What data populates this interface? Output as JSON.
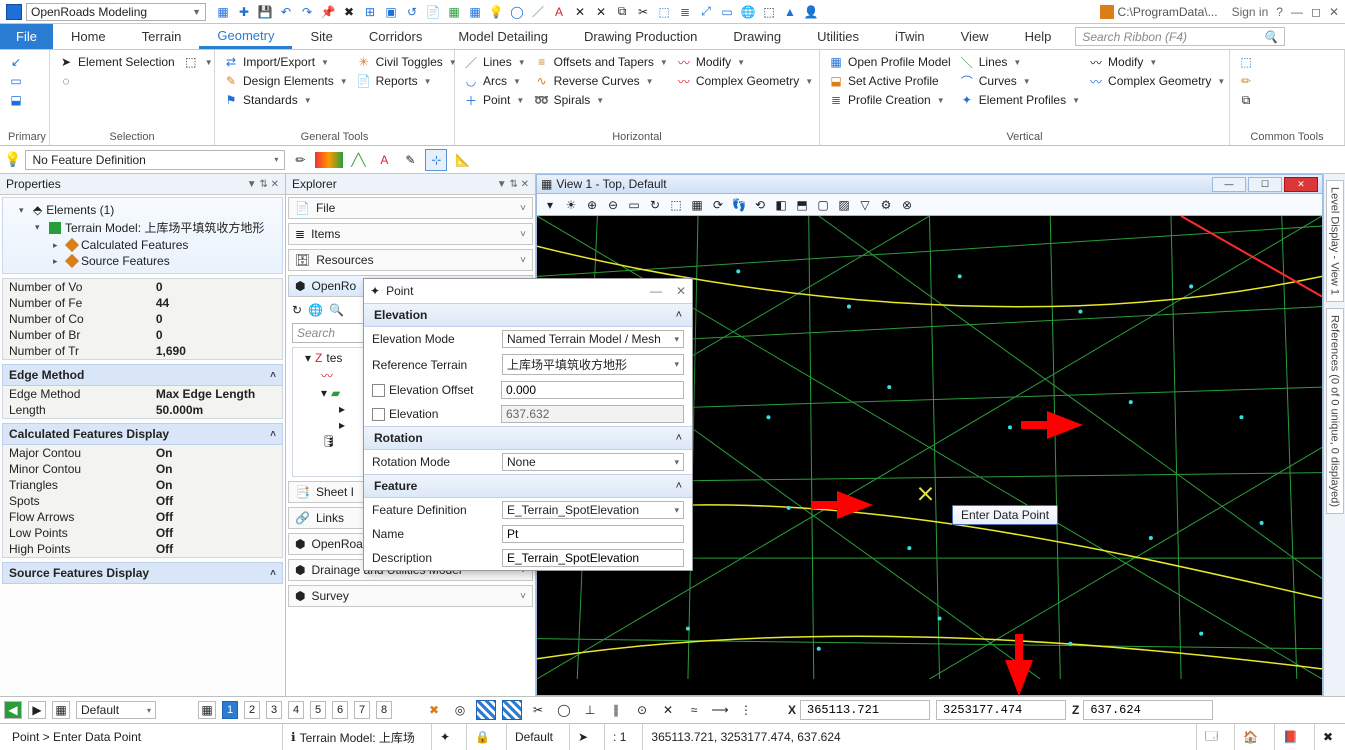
{
  "title": {
    "workflow": "OpenRoads Modeling",
    "path_prefix": "C:\\ProgramData\\...",
    "signin": "Sign in",
    "help_q": "?"
  },
  "tabs": {
    "file": "File",
    "home": "Home",
    "terrain": "Terrain",
    "geometry": "Geometry",
    "site": "Site",
    "corridors": "Corridors",
    "model_detailing": "Model Detailing",
    "drawing_production": "Drawing Production",
    "drawing": "Drawing",
    "utilities": "Utilities",
    "itwin": "iTwin",
    "view": "View",
    "help": "Help"
  },
  "search_ribbon_placeholder": "Search Ribbon (F4)",
  "ribbon": {
    "primary": "Primary",
    "selection": {
      "label": "Selection",
      "element_selection": "Element Selection"
    },
    "general": {
      "label": "General Tools",
      "import_export": "Import/Export",
      "design_elements": "Design Elements",
      "standards": "Standards",
      "civil_toggles": "Civil Toggles",
      "reports": "Reports"
    },
    "horizontal": {
      "label": "Horizontal",
      "lines": "Lines",
      "arcs": "Arcs",
      "point": "Point",
      "offsets": "Offsets and Tapers",
      "reverse": "Reverse Curves",
      "spirals": "Spirals",
      "modify": "Modify",
      "complex": "Complex Geometry"
    },
    "vertical": {
      "label": "Vertical",
      "open_profile": "Open Profile Model",
      "set_active": "Set Active Profile",
      "profile_creation": "Profile Creation",
      "lines": "Lines",
      "curves": "Curves",
      "element_profiles": "Element Profiles",
      "modify": "Modify",
      "complex": "Complex Geometry"
    },
    "common": {
      "label": "Common Tools"
    }
  },
  "featbar": {
    "value": "No Feature Definition"
  },
  "props": {
    "title": "Properties",
    "tree": {
      "elements": "Elements (1)",
      "terrain_model": "Terrain Model: 上库场平填筑收方地形",
      "calc": "Calculated Features",
      "source": "Source Features"
    },
    "stats": {
      "vo_k": "Number of Vo",
      "vo_v": "0",
      "fe_k": "Number of Fe",
      "fe_v": "44",
      "co_k": "Number of Co",
      "co_v": "0",
      "br_k": "Number of Br",
      "br_v": "0",
      "tr_k": "Number of Tr",
      "tr_v": "1,690"
    },
    "edge": {
      "hdr": "Edge Method",
      "method_k": "Edge Method",
      "method_v": "Max Edge Length",
      "len_k": "Length",
      "len_v": "50.000m"
    },
    "calc": {
      "hdr": "Calculated Features Display",
      "major_k": "Major Contou",
      "major_v": "On",
      "minor_k": "Minor Contou",
      "minor_v": "On",
      "tri_k": "Triangles",
      "tri_v": "On",
      "spots_k": "Spots",
      "spots_v": "Off",
      "flow_k": "Flow Arrows",
      "flow_v": "Off",
      "low_k": "Low Points",
      "low_v": "Off",
      "high_k": "High Points",
      "high_v": "Off"
    },
    "src": {
      "hdr": "Source Features Display"
    }
  },
  "explorer": {
    "title": "Explorer",
    "file": "File",
    "items": "Items",
    "resources": "Resources",
    "openroads": "OpenRo",
    "sheet": "Sheet I",
    "links": "Links",
    "openroads_std": "OpenRoads Standards",
    "drainage": "Drainage and Utilities Model",
    "survey": "Survey",
    "search_placeholder": "Search",
    "tree": {
      "root": "tes"
    }
  },
  "view": {
    "title": "View 1 - Top, Default",
    "tooltip": "Enter Data Point"
  },
  "right_tabs": {
    "level": "Level Display - View 1",
    "refs": "References (0 of 0 unique, 0 displayed)"
  },
  "point_dlg": {
    "title": "Point",
    "sec_elev": "Elevation",
    "sec_rot": "Rotation",
    "sec_feat": "Feature",
    "elev_mode_k": "Elevation Mode",
    "elev_mode_v": "Named Terrain Model / Mesh",
    "ref_terr_k": "Reference Terrain",
    "ref_terr_v": "上库场平填筑收方地形",
    "elev_off_k": "Elevation Offset",
    "elev_off_v": "0.000",
    "elev_k": "Elevation",
    "elev_v": "637.632",
    "rot_mode_k": "Rotation Mode",
    "rot_mode_v": "None",
    "feat_def_k": "Feature Definition",
    "feat_def_v": "E_Terrain_SpotElevation",
    "name_k": "Name",
    "name_v": "Pt",
    "desc_k": "Description",
    "desc_v": "E_Terrain_SpotElevation"
  },
  "bar1": {
    "active_model": "Default",
    "scale_prefix": ": 1",
    "x": "365113.721",
    "y": "3253177.474",
    "z": "637.624",
    "views": [
      "1",
      "2",
      "3",
      "4",
      "5",
      "6",
      "7",
      "8"
    ]
  },
  "bar2": {
    "prompt": "Point > Enter Data Point",
    "terrain_model": "Terrain Model: 上库场",
    "level": "Default",
    "coords": "365113.721, 3253177.474, 637.624"
  }
}
